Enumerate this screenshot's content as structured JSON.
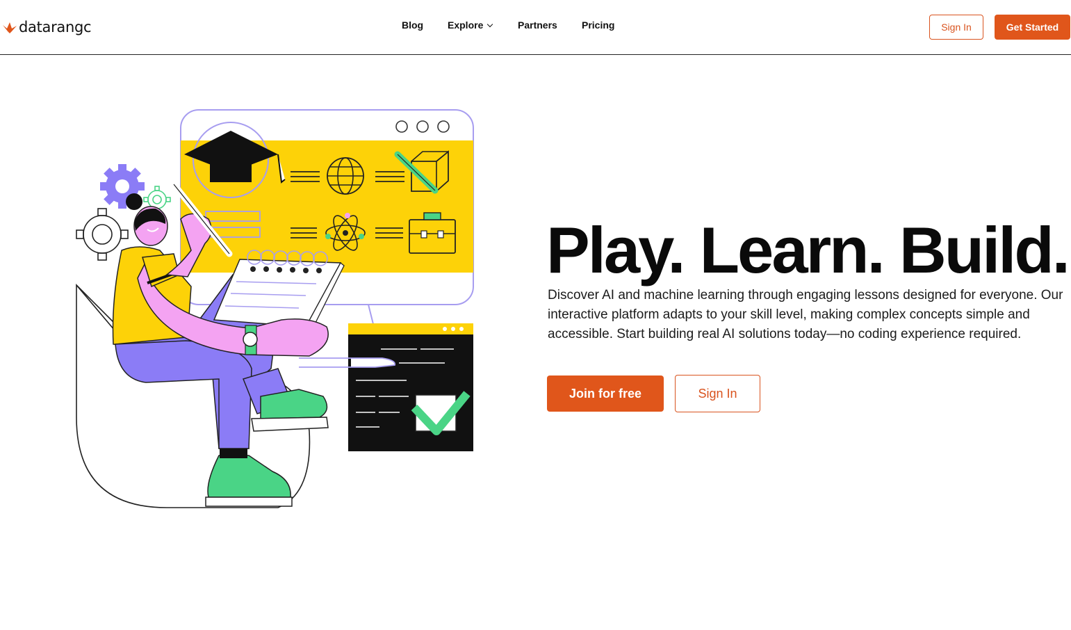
{
  "header": {
    "logo_text": "datarangc",
    "logo_icon": "bird-icon",
    "nav": {
      "blog": "Blog",
      "explore": "Explore",
      "partners": "Partners",
      "pricing": "Pricing"
    },
    "sign_in": "Sign In",
    "get_started": "Get Started"
  },
  "hero": {
    "title": "Play. Learn. Build.",
    "description": "Discover AI and machine learning through engaging lessons designed for everyone. Our interactive platform adapts to your skill level, making complex concepts simple and accessible. Start building real AI solutions today—no coding experience required.",
    "join_label": "Join for free",
    "sign_in_label": "Sign In",
    "illustration": "student-learning-illustration"
  },
  "colors": {
    "accent": "#e0561b",
    "yellow": "#fdd208",
    "purple": "#8b7cf6",
    "pink": "#f4a3f2",
    "green": "#4ad486"
  }
}
